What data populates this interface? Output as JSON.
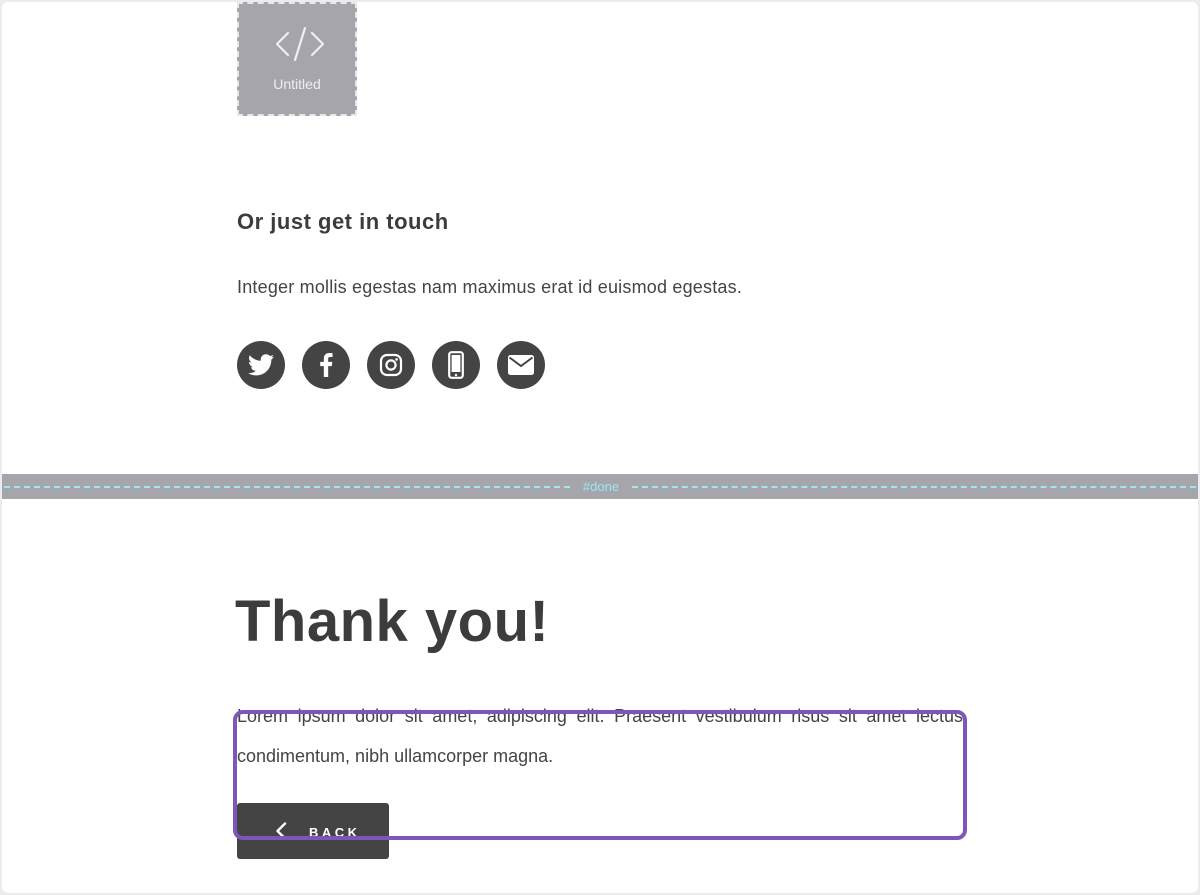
{
  "placeholder": {
    "icon": "code-icon",
    "label": "Untitled"
  },
  "contact": {
    "heading": "Or just get in touch",
    "text": "Integer mollis egestas nam maximus erat id euismod egestas.",
    "social_icons": [
      "twitter-icon",
      "facebook-icon",
      "instagram-icon",
      "phone-icon",
      "email-icon"
    ]
  },
  "anchor": {
    "label": "#done"
  },
  "done": {
    "heading": "Thank you!",
    "text": "Lorem ipsum dolor sit amet, adipiscing elit. Praesent vestibulum risus sit amet lectus condimentum, nibh ullamcorper magna.",
    "back_label": "BACK"
  },
  "colors": {
    "text": "#444444",
    "placeholder_bg": "#a6a5ab",
    "anchor_accent": "#9ee7ee",
    "highlight": "#7c56b8"
  }
}
